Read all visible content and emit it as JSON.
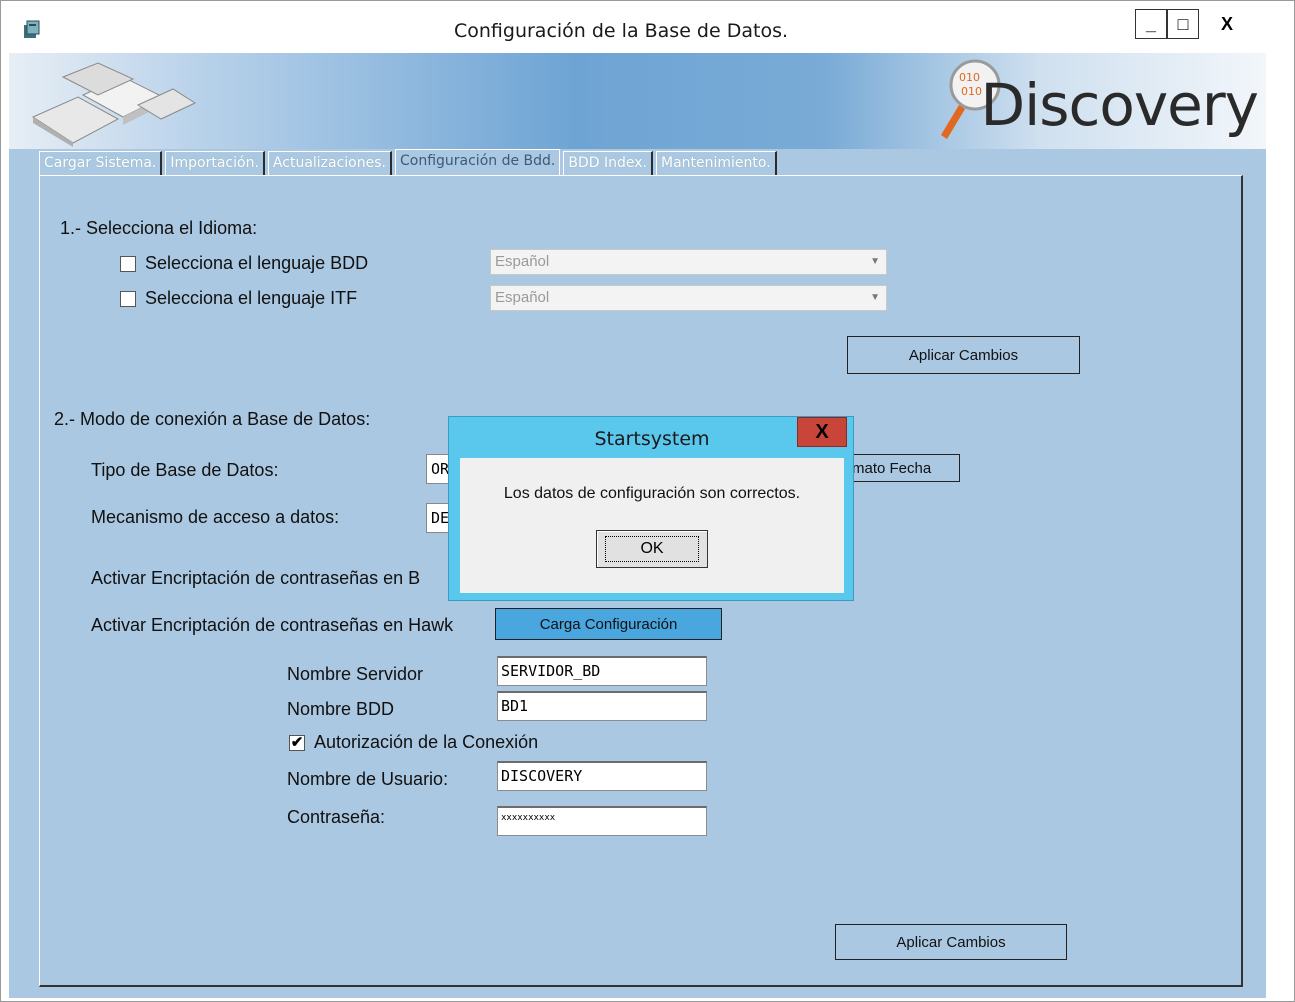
{
  "window": {
    "title": "Configuración de la Base de Datos.",
    "minimize": "_",
    "maximize": "□",
    "close": "X"
  },
  "banner": {
    "logo": "Discovery"
  },
  "tabs": [
    {
      "label": "Cargar Sistema."
    },
    {
      "label": "Importación."
    },
    {
      "label": "Actualizaciones."
    },
    {
      "label": "Configuración de Bdd."
    },
    {
      "label": "BDD Index."
    },
    {
      "label": "Mantenimiento."
    }
  ],
  "section1": {
    "heading": "1.- Selecciona el Idioma:",
    "bdd_label": "Selecciona el lenguaje BDD",
    "bdd_value": "Español",
    "itf_label": "Selecciona el lenguaje ITF",
    "itf_value": "Español",
    "apply": "Aplicar Cambios"
  },
  "section2": {
    "heading": "2.- Modo de conexión a Base de Datos:",
    "tipo_label": "Tipo de Base de Datos:",
    "tipo_value": "OR",
    "formato_btn": "rmato Fecha",
    "mecanismo_label": "Mecanismo de acceso a datos:",
    "mecanismo_value": "DE",
    "encrypt_b_label": "Activar Encriptación de contraseñas en B",
    "encrypt_hawk_label": "Activar Encriptación de contraseñas en Hawk",
    "carga_btn": "Carga Configuración",
    "servidor_label": "Nombre Servidor",
    "servidor_value": "SERVIDOR_BD",
    "bdd_label": "Nombre BDD",
    "bdd_value": "BD1",
    "auth_label": "Autorización de la Conexión",
    "auth_checked": "✔",
    "usuario_label": "Nombre de Usuario:",
    "usuario_value": "DISCOVERY",
    "password_label": "Contraseña:",
    "password_value": "xxxxxxxxxx",
    "apply": "Aplicar Cambios"
  },
  "dialog": {
    "title": "Startsystem",
    "close": "X",
    "message": "Los datos de configuración son correctos.",
    "ok": "OK"
  }
}
